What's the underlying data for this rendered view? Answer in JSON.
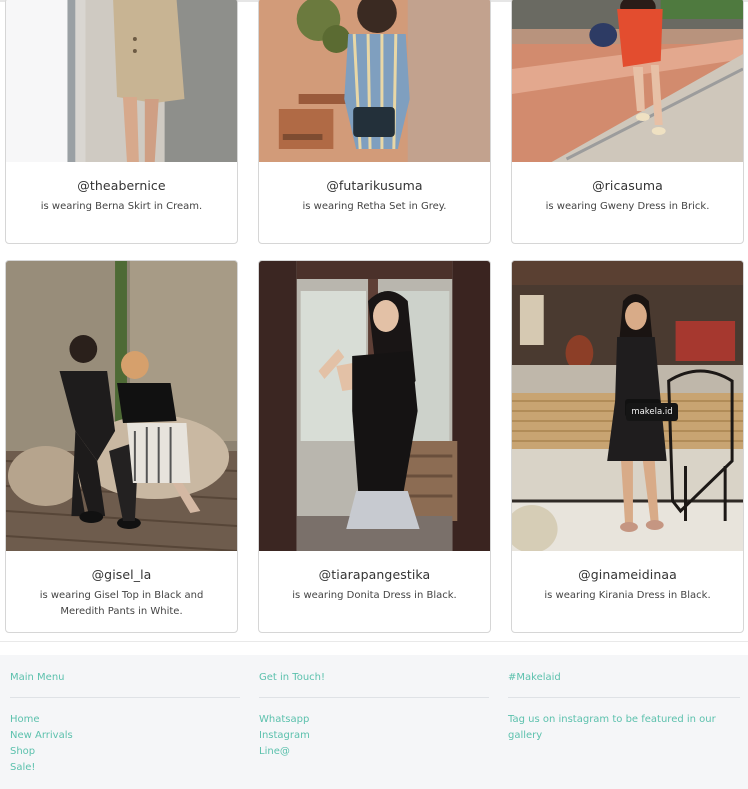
{
  "gallery": [
    {
      "handle": "@theabernice",
      "caption": "is wearing Berna Skirt in Cream."
    },
    {
      "handle": "@futarikusuma",
      "caption": "is wearing Retha Set in Grey."
    },
    {
      "handle": "@ricasuma",
      "caption": "is wearing Gweny Dress in Brick."
    },
    {
      "handle": "@gisel_la",
      "caption": "is wearing Gisel Top in Black and Meredith Pants in White."
    },
    {
      "handle": "@tiarapangestika",
      "caption": "is wearing Donita Dress in Black."
    },
    {
      "handle": "@ginameidinaa",
      "caption": "is wearing Kirania Dress in Black."
    }
  ],
  "photo_watermark": "makela.id",
  "footer": {
    "main_menu": {
      "heading": "Main Menu",
      "links": [
        "Home",
        "New Arrivals",
        "Shop",
        "Sale!"
      ]
    },
    "get_in_touch": {
      "heading": "Get in Touch!",
      "links": [
        "Whatsapp",
        "Instagram",
        "Line@"
      ]
    },
    "hashtag": {
      "heading": "#Makelaid",
      "text": "Tag us on instagram to be featured in our gallery"
    }
  },
  "colors": {
    "accent": "#5cc1ad",
    "footer_bg": "#f5f6f8",
    "card_border": "#d6d6d6"
  }
}
